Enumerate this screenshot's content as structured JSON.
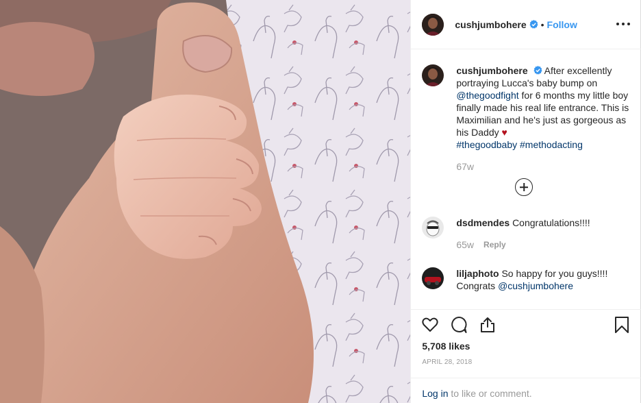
{
  "post": {
    "author": "cushjumbohere",
    "follow_label": "Follow",
    "separator": "•",
    "more_icon": "more-horizontal-icon"
  },
  "caption": {
    "username": "cushjumbohere",
    "text_part1": "After excellently portraying Lucca's baby bump on ",
    "mention": "@thegoodfight",
    "text_part2": " for 6 months my little boy finally made his real life entrance. This is Maximilian and he's just as gorgeous as his Daddy ",
    "heart": "♥",
    "hashtag1": "#thegoodbaby",
    "hashtag2": "#methodacting",
    "age": "67w"
  },
  "comments": [
    {
      "username": "dsdmendes",
      "text": "Congratulations!!!!",
      "age": "65w",
      "reply_label": "Reply"
    },
    {
      "username": "liljaphoto",
      "text": "So happy for you guys!!!! Congrats ",
      "mention": "@cushjumbohere"
    }
  ],
  "actions": {
    "likes": "5,708 likes",
    "date": "APRIL 28, 2018"
  },
  "login": {
    "link": "Log in",
    "rest": " to like or comment."
  },
  "colors": {
    "link_blue": "#3897f0",
    "mention": "#003569",
    "heart_red": "#b3121e",
    "muted": "#999999"
  }
}
